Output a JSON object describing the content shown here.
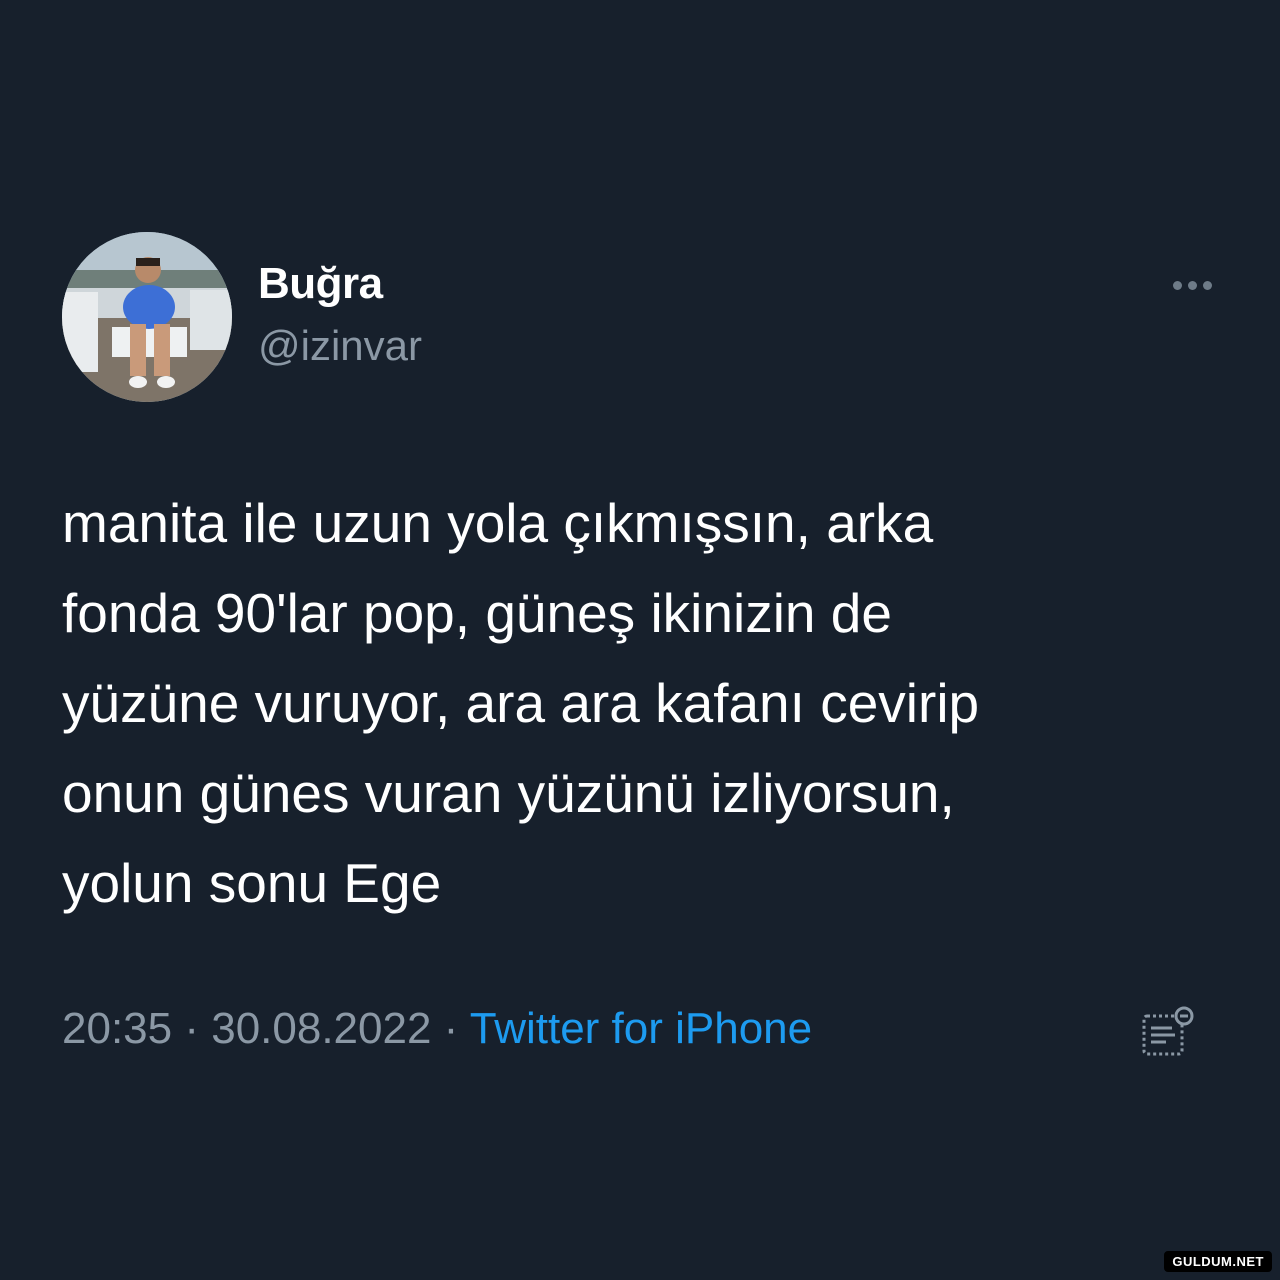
{
  "author": {
    "display_name": "Buğra",
    "handle": "@izinvar",
    "avatar_icon": "profile-photo"
  },
  "tweet": {
    "lines": [
      "manita ile uzun yola çıkmışsın, arka",
      "fonda 90'lar pop, güneş ikinizin de",
      "yüzüne vuruyor, ara ara kafanı cevirip",
      "onun günes vuran yüzünü izliyorsun,",
      "yolun sonu Ege"
    ]
  },
  "meta": {
    "time": "20:35",
    "separator": " · ",
    "date": "30.08.2022",
    "source": "Twitter for iPhone"
  },
  "icons": {
    "more": "more-horizontal-icon",
    "analytics": "tweet-analytics-icon"
  },
  "colors": {
    "background": "#17202c",
    "primary_text": "#ffffff",
    "secondary_text": "#8b98a5",
    "link": "#1d9bf0"
  },
  "watermark": "GULDUM.NET"
}
